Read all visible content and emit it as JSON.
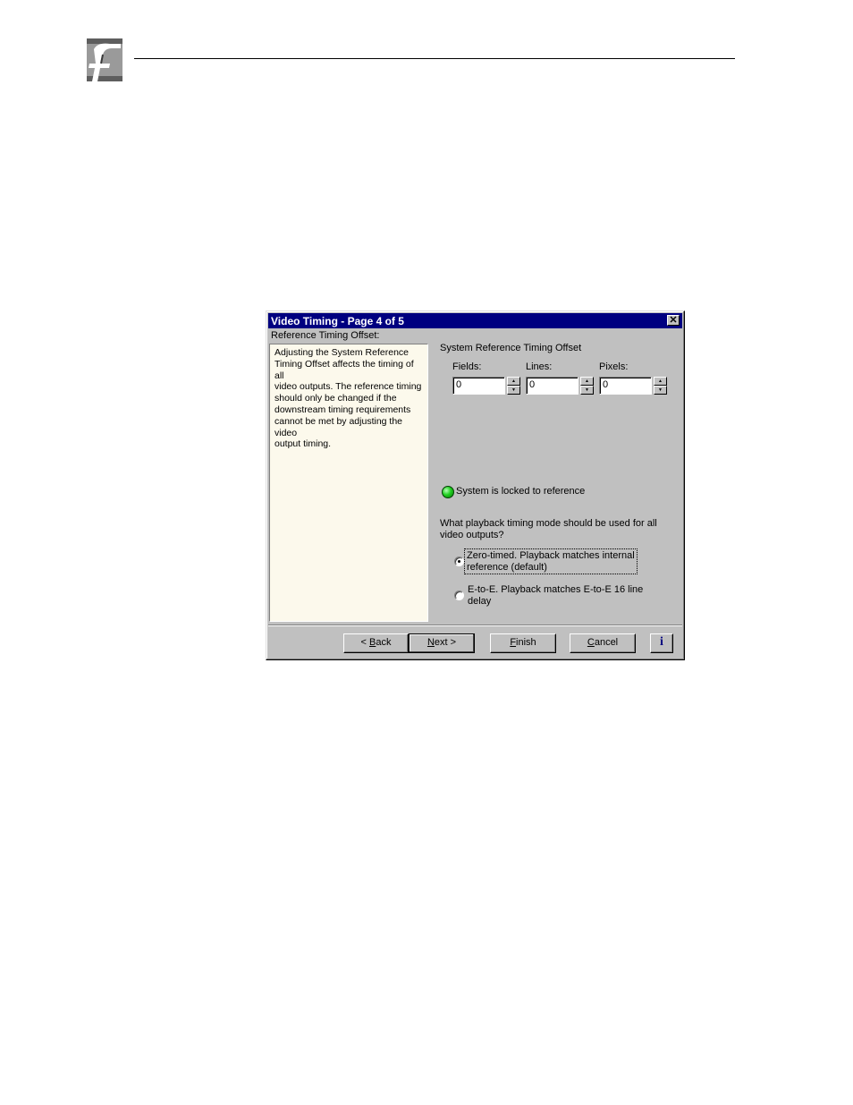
{
  "dialog": {
    "title": "Video Timing - Page 4 of 5",
    "close_glyph": "✕",
    "reference_label": "Reference Timing Offset:",
    "description": "Adjusting the System Reference\nTiming Offset affects the timing of all\nvideo outputs.  The reference timing\nshould only be changed if the\ndownstream timing requirements\ncannot be met by adjusting the video\noutput timing.",
    "group_title": "System Reference Timing Offset",
    "fields": [
      {
        "label": "Fields:",
        "value": "0"
      },
      {
        "label": "Lines:",
        "value": "0"
      },
      {
        "label": "Pixels:",
        "value": "0"
      }
    ],
    "spinner": {
      "up": "▲",
      "down": "▼"
    },
    "status": {
      "text": "System is locked to reference",
      "color": "#20d020"
    },
    "question": "What playback timing mode should be used for all\nvideo outputs?",
    "options": [
      {
        "label": "Zero-timed. Playback matches internal\nreference (default)",
        "selected": true
      },
      {
        "label": "E-to-E. Playback matches E-to-E 16 line\ndelay",
        "selected": false
      }
    ],
    "buttons": {
      "back": {
        "acc": "B",
        "rest": "ack",
        "prefix": "< "
      },
      "next": {
        "acc": "N",
        "rest": "ext >"
      },
      "finish": {
        "acc": "F",
        "rest": "inish"
      },
      "cancel": {
        "acc": "C",
        "rest": "ancel"
      },
      "info": "i"
    }
  },
  "colors": {
    "titlebar": "#000080",
    "dialog_bg": "#c0c0c0",
    "description_bg": "#fcf9ec"
  },
  "icons": [
    "company-logo-icon",
    "close-icon",
    "spin-up-icon",
    "spin-down-icon",
    "status-led-icon",
    "info-icon"
  ]
}
